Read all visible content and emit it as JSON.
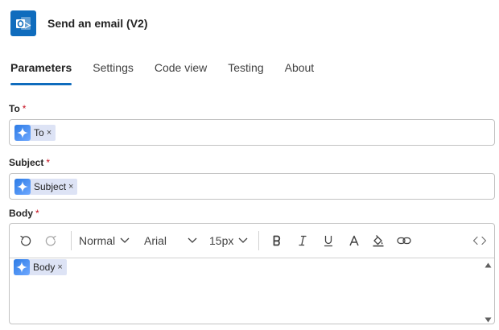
{
  "header": {
    "title": "Send an email (V2)",
    "icon": "outlook-icon"
  },
  "tabs": [
    {
      "label": "Parameters",
      "active": true
    },
    {
      "label": "Settings",
      "active": false
    },
    {
      "label": "Code view",
      "active": false
    },
    {
      "label": "Testing",
      "active": false
    },
    {
      "label": "About",
      "active": false
    }
  ],
  "fields": {
    "to": {
      "label": "To",
      "required": "*",
      "token": "To",
      "token_remove": "×"
    },
    "subject": {
      "label": "Subject",
      "required": "*",
      "token": "Subject",
      "token_remove": "×"
    },
    "body": {
      "label": "Body",
      "required": "*",
      "token": "Body",
      "token_remove": "×"
    }
  },
  "toolbar": {
    "format": "Normal",
    "font": "Arial",
    "size": "15px",
    "icons": [
      "undo-icon",
      "redo-icon",
      "bold-icon",
      "italic-icon",
      "underline-icon",
      "font-color-icon",
      "highlight-icon",
      "link-icon",
      "code-view-icon"
    ]
  },
  "colors": {
    "accent": "#0f6cbd",
    "required": "#c50f1f",
    "token_bg": "#dde3f5"
  }
}
